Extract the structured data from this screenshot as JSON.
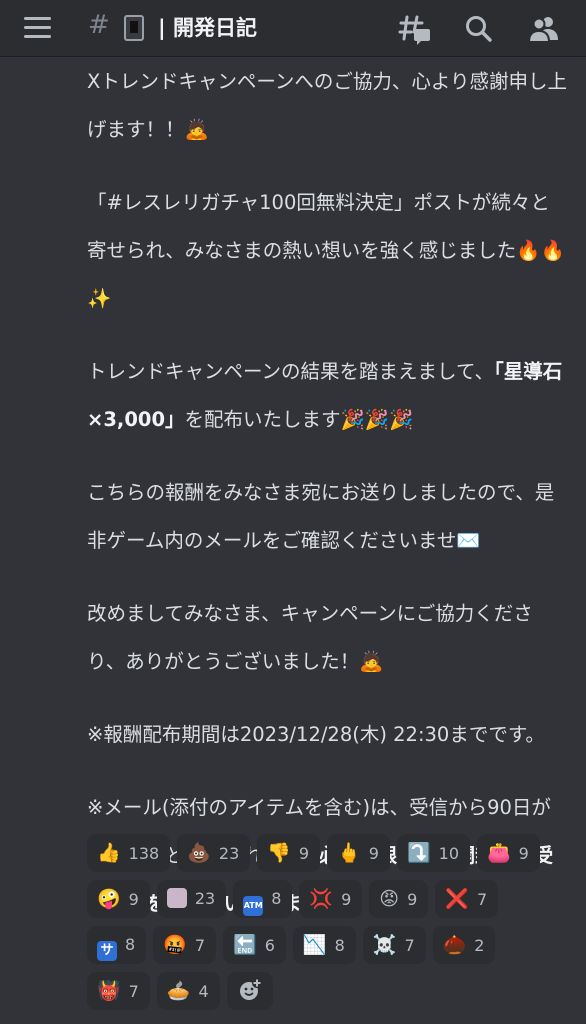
{
  "header": {
    "hash_symbol": "#",
    "channel_name": "| 開発日記"
  },
  "message": {
    "paragraphs": {
      "p1": "Xトレンドキャンペーンへのご協力、心より感謝申し上げます！！🙇",
      "p2": "「#レスレリガチャ100回無料決定」ポストが続々と寄せられ、みなさまの熱い想いを強く感じました🔥🔥✨",
      "p3_text": "トレンドキャンペーンの結果を踏まえまして、",
      "p3_bold": "「星導石×3,000」",
      "p3_tail": "を配布いたします🎉🎉🎉",
      "p4": "こちらの報酬をみなさま宛にお送りしましたので、是非ゲーム内のメールをご確認くださいませ✉️",
      "p5": "改めましてみなさま、キャンペーンにご協力くださり、ありがとうございました！🙇",
      "p6": "※報酬配布期間は2023/12/28(木) 22:30までです。",
      "p7_text": "※メール(添付のアイテムを含む)は、受信から90日が経過すると削除されます。",
      "p7_bold": "必ず期限以内に開封とお受け取りをお願いいたします。"
    }
  },
  "reactions": [
    {
      "emoji": "👍",
      "icon": "thumbs-up",
      "count": "138"
    },
    {
      "emoji": "💩",
      "icon": "poop",
      "count": "23"
    },
    {
      "emoji": "👎",
      "icon": "thumbs-down",
      "count": "9"
    },
    {
      "emoji": "🖕",
      "icon": "middle-finger",
      "count": "9"
    },
    {
      "emoji": "⤵️",
      "icon": "arrow-down-turn",
      "count": "10"
    },
    {
      "emoji": "👛",
      "icon": "purse",
      "count": "9"
    },
    {
      "emoji": "🤪",
      "icon": "zany-face",
      "count": "9"
    },
    {
      "emoji": "",
      "icon": "custom-anime-girl",
      "count": "23"
    },
    {
      "emoji": "ATM",
      "icon": "atm-sign",
      "count": "8"
    },
    {
      "emoji": "💢",
      "icon": "anger-symbol",
      "count": "9"
    },
    {
      "emoji": "😡",
      "icon": "angry-face",
      "count": "9"
    },
    {
      "emoji": "❌",
      "icon": "cross-mark",
      "count": "7"
    },
    {
      "emoji": "サ",
      "icon": "katakana-sa",
      "count": "8"
    },
    {
      "emoji": "🤬",
      "icon": "cursing-face",
      "count": "7"
    },
    {
      "emoji": "🔚",
      "icon": "end-arrow",
      "count": "6"
    },
    {
      "emoji": "📉",
      "icon": "chart-decreasing",
      "count": "8"
    },
    {
      "emoji": "☠️",
      "icon": "skull-crossbones",
      "count": "7"
    },
    {
      "emoji": "🌰",
      "icon": "chestnut",
      "count": "2"
    },
    {
      "emoji": "👹",
      "icon": "ogre",
      "count": "7"
    },
    {
      "emoji": "🥧",
      "icon": "pie",
      "count": "4"
    }
  ],
  "colors": {
    "background": "#313338",
    "topbar": "#2b2d31",
    "text": "#dbdee1",
    "reaction_bg": "#2b2d31"
  }
}
